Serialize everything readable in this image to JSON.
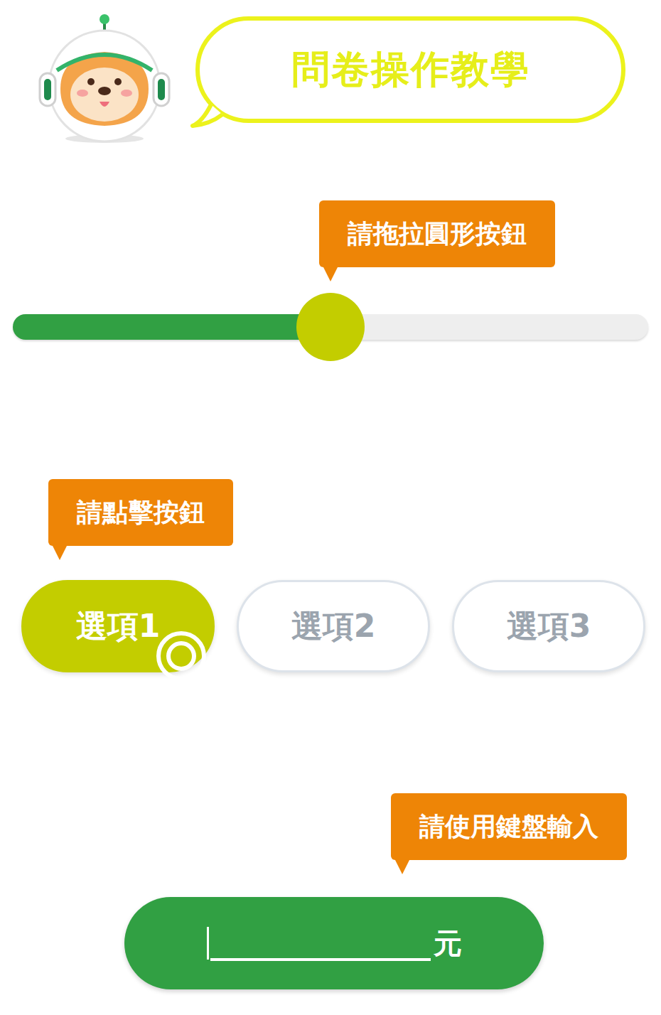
{
  "header": {
    "title": "問卷操作教學"
  },
  "slider": {
    "hint": "請拖拉圓形按鈕",
    "level": 0.5
  },
  "options": {
    "hint": "請點擊按鈕",
    "items": [
      {
        "label": "選項1",
        "selected": true
      },
      {
        "label": "選項2",
        "selected": false
      },
      {
        "label": "選項3",
        "selected": false
      }
    ]
  },
  "amount": {
    "hint": "請使用鍵盤輸入",
    "unit": "元"
  }
}
